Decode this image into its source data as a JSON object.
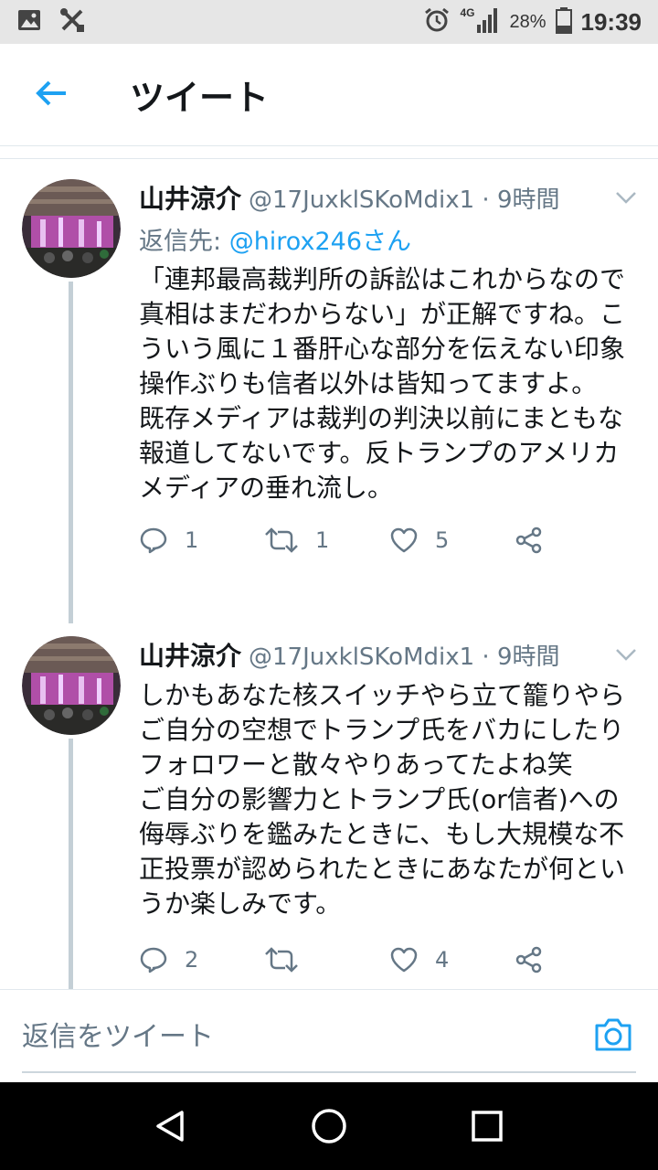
{
  "status_bar": {
    "network": "4G",
    "battery": "28%",
    "time": "19:39"
  },
  "header": {
    "title": "ツイート"
  },
  "tweets": [
    {
      "name": "山井涼介",
      "handle": "@17JuxklSKoMdix1 · 9時間",
      "reply_to_prefix": "返信先: ",
      "reply_to_user": "@hirox246さん",
      "text": "「連邦最高裁判所の訴訟はこれからなので真相はまだわからない」が正解ですね。こういう風に１番肝心な部分を伝えない印象操作ぶりも信者以外は皆知ってますよ。\n既存メディアは裁判の判決以前にまともな報道してないです。反トランプのアメリカメディアの垂れ流し。",
      "replies": "1",
      "retweets": "1",
      "likes": "5"
    },
    {
      "name": "山井涼介",
      "handle": "@17JuxklSKoMdix1 · 9時間",
      "text": "しかもあなた核スイッチやら立て籠りやらご自分の空想でトランプ氏をバカにしたりフォロワーと散々やりあってたよね笑\nご自分の影響力とトランプ氏(or信者)への侮辱ぶりを鑑みたときに、もし大規模な不正投票が認められたときにあなたが何というか楽しみです。",
      "replies": "2",
      "retweets": "",
      "likes": "4"
    }
  ],
  "composer": {
    "placeholder": "返信をツイート"
  },
  "colors": {
    "accent": "#1da1f2",
    "secondary_text": "#657786",
    "status_bar_bg": "#e6e6e6",
    "nav_bar_bg": "#000000"
  },
  "icons": {
    "status_left": [
      "image-icon",
      "tools-icon"
    ],
    "status_right": [
      "alarm-icon",
      "signal-icon",
      "battery-icon"
    ],
    "tweet_actions": [
      "reply-icon",
      "retweet-icon",
      "like-icon",
      "share-icon"
    ],
    "nav": [
      "back-triangle-icon",
      "home-circle-icon",
      "recents-square-icon"
    ]
  }
}
